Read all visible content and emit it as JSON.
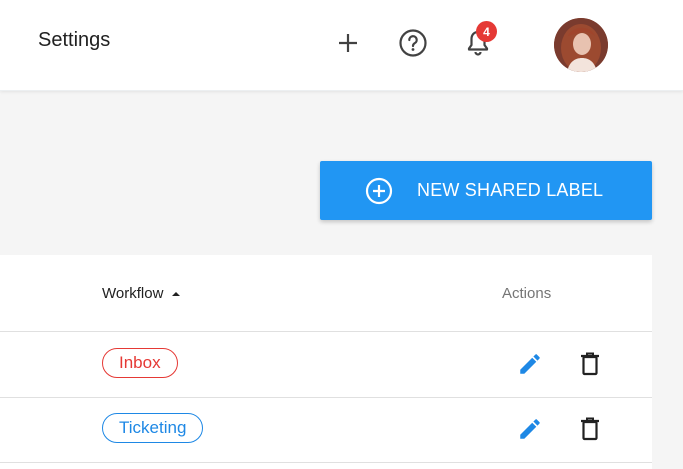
{
  "header": {
    "title": "Settings",
    "notification_count": "4",
    "icons": [
      "plus-icon",
      "help-circle-icon",
      "bell-icon"
    ]
  },
  "toolbar": {
    "new_shared_label": "NEW SHARED LABEL"
  },
  "table": {
    "columns": [
      "Workflow",
      "Actions"
    ],
    "sort": "ascending",
    "rows": [
      {
        "workflow": "Inbox",
        "color": "#e53935"
      },
      {
        "workflow": "Ticketing",
        "color": "#1e88e5"
      }
    ]
  },
  "colors": {
    "primary": "#2196f3",
    "edit_icon": "#1e88e5",
    "badge": "#e53935"
  }
}
